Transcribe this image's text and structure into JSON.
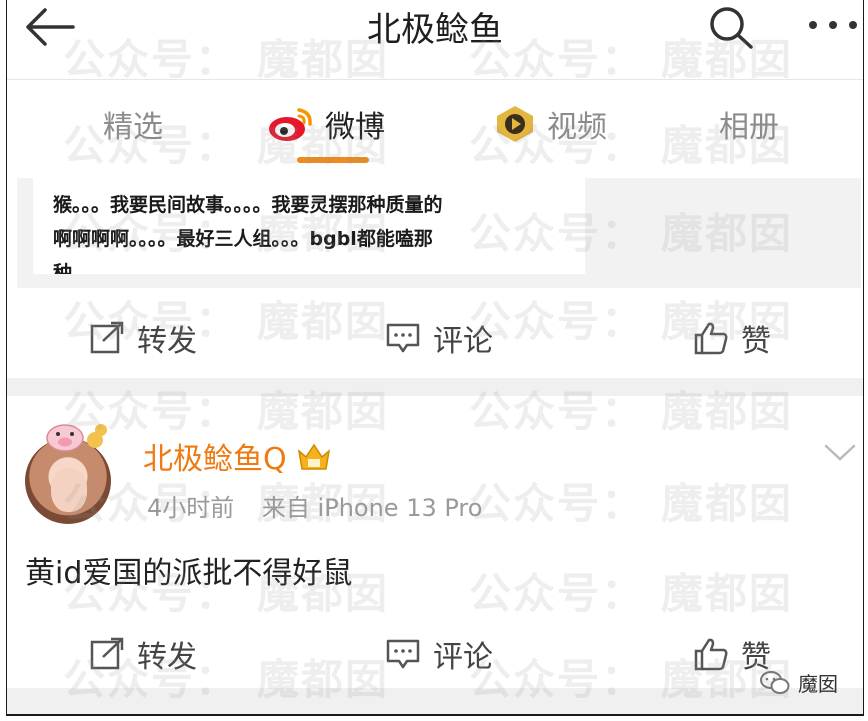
{
  "header": {
    "title": "北极鲶鱼"
  },
  "tabs": [
    {
      "label": "精选",
      "active": false
    },
    {
      "label": "微博",
      "active": true
    },
    {
      "label": "视频",
      "active": false
    },
    {
      "label": "相册",
      "active": false
    }
  ],
  "post1": {
    "quote_lines": [
      "猴。。。我要民间故事。。。。我要灵摆那种质量的",
      "啊啊啊啊。。。。最好三人组。。。bgbl都能嗑那",
      "种"
    ],
    "actions": {
      "repost": "转发",
      "comment": "评论",
      "like": "赞"
    }
  },
  "post2": {
    "username": "北极鲶鱼Q",
    "time": "4小时前",
    "source": "来自 iPhone 13 Pro",
    "text": "黄id爱国的派批不得好鼠",
    "actions": {
      "repost": "转发",
      "comment": "评论",
      "like": "赞"
    }
  },
  "watermark": {
    "text_a": "公众号：",
    "text_b": "魔都囡"
  },
  "badge": {
    "label": "魔囡"
  },
  "colors": {
    "accent_orange": "#f08a1c",
    "username_orange": "#f07a12",
    "weibo_red": "#e6162d"
  }
}
